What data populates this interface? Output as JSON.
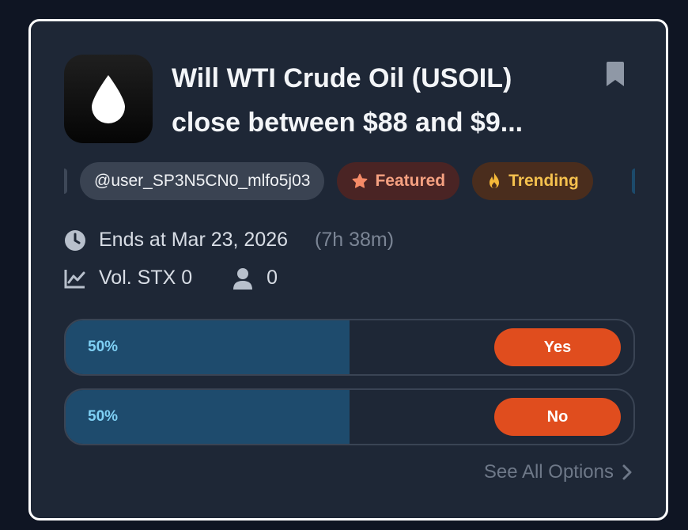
{
  "market": {
    "title_line1": "Will WTI Crude Oil (USOIL)",
    "title_line2": "close between $88 and $9...",
    "icon": "droplet-icon"
  },
  "tags": {
    "user": "@user_SP3N5CN0_mlfo5j03",
    "featured": "Featured",
    "trending": "Trending"
  },
  "info": {
    "ends_at": "Ends at Mar 23, 2026",
    "time_left": "(7h 38m)",
    "volume": "Vol. STX 0",
    "participants": "0"
  },
  "options": [
    {
      "percent_label": "50%",
      "percent": 50,
      "button_label": "Yes"
    },
    {
      "percent_label": "50%",
      "percent": 50,
      "button_label": "No"
    }
  ],
  "footer": {
    "see_all": "See All Options"
  },
  "colors": {
    "accent": "#e04d1e",
    "fill": "#1e4b6d",
    "percent_text": "#7fd0f4",
    "card_bg": "#1e2736"
  }
}
